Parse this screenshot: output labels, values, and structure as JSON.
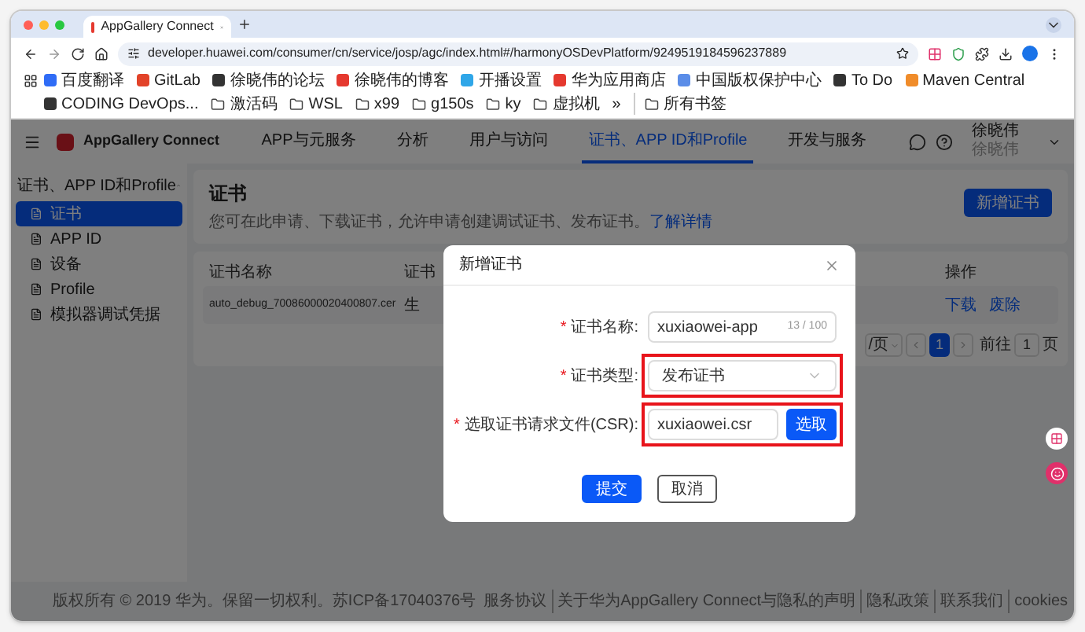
{
  "browser": {
    "tab_title": "AppGallery Connect",
    "url": "developer.huawei.com/consumer/cn/service/josp/agc/index.html#/harmonyOSDevPlatform/9249519184596237889",
    "bookmarks": [
      {
        "label": "百度翻译",
        "kind": "site"
      },
      {
        "label": "GitLab",
        "kind": "site"
      },
      {
        "label": "徐晓伟的论坛",
        "kind": "site"
      },
      {
        "label": "徐晓伟的博客",
        "kind": "site"
      },
      {
        "label": "开播设置",
        "kind": "site"
      },
      {
        "label": "华为应用商店",
        "kind": "site"
      },
      {
        "label": "中国版权保护中心",
        "kind": "site"
      },
      {
        "label": "To Do",
        "kind": "site"
      },
      {
        "label": "Maven Central",
        "kind": "site"
      },
      {
        "label": "CODING DevOps...",
        "kind": "site"
      },
      {
        "label": "激活码",
        "kind": "folder"
      },
      {
        "label": "WSL",
        "kind": "folder"
      },
      {
        "label": "x99",
        "kind": "folder"
      },
      {
        "label": "g150s",
        "kind": "folder"
      },
      {
        "label": "ky",
        "kind": "folder"
      },
      {
        "label": "虚拟机",
        "kind": "folder"
      }
    ],
    "overflow": "»",
    "all_bookmarks": "所有书签"
  },
  "header": {
    "product": "AppGallery Connect",
    "tabs": [
      {
        "label": "APP与元服务",
        "selected": false
      },
      {
        "label": "分析",
        "selected": false
      },
      {
        "label": "用户与访问",
        "selected": false
      },
      {
        "label": "证书、APP ID和Profile",
        "selected": true
      },
      {
        "label": "开发与服务",
        "selected": false
      }
    ],
    "user_name": "徐晓伟",
    "user_sub": "徐晓伟"
  },
  "sidebar": {
    "group": {
      "label": "证书、APP ID和Profile",
      "expanded": true
    },
    "items": [
      {
        "label": "证书",
        "selected": true
      },
      {
        "label": "APP ID",
        "selected": false
      },
      {
        "label": "设备",
        "selected": false
      },
      {
        "label": "Profile",
        "selected": false
      },
      {
        "label": "模拟器调试凭据",
        "selected": false
      }
    ]
  },
  "page": {
    "title": "证书",
    "description": "您可在此申请、下载证书，允许申请创建调试证书、发布证书。",
    "link": "了解详情",
    "new_button": "新增证书"
  },
  "table": {
    "columns": [
      "证书名称",
      "证书",
      "操作"
    ],
    "rows": [
      {
        "cells": [
          "auto_debug_70086000020400807.cer",
          "生"
        ],
        "actions": [
          "下载",
          "废除"
        ]
      }
    ]
  },
  "pagination": {
    "page_size": "/页",
    "pages": [
      {
        "label": "1",
        "selected": true
      }
    ],
    "goto_label": "前往",
    "goto_value": "1",
    "goto_suffix": "页"
  },
  "footer": {
    "copyright": "版权所有 © 2019 华为。保留一切权利。苏ICP备17040376号",
    "links": [
      "服务协议",
      "关于华为AppGallery Connect与隐私的声明",
      "隐私政策",
      "联系我们",
      "cookies"
    ]
  },
  "dialog": {
    "title": "新增证书",
    "fields": [
      {
        "kind": "text",
        "marker": "*",
        "label": "证书名称:",
        "value": "xuxiaowei-app",
        "counter": "13 / 100",
        "highlighted": false
      },
      {
        "kind": "select",
        "marker": "*",
        "label": "证书类型:",
        "value": "发布证书",
        "highlighted": true
      },
      {
        "kind": "file",
        "marker": "*",
        "label": "选取证书请求文件(CSR):",
        "value": "xuxiaowei.csr",
        "button": "选取",
        "highlighted": true
      }
    ],
    "buttons": [
      {
        "label": "提交",
        "kind": "primary"
      },
      {
        "label": "取消",
        "kind": "secondary"
      }
    ]
  }
}
